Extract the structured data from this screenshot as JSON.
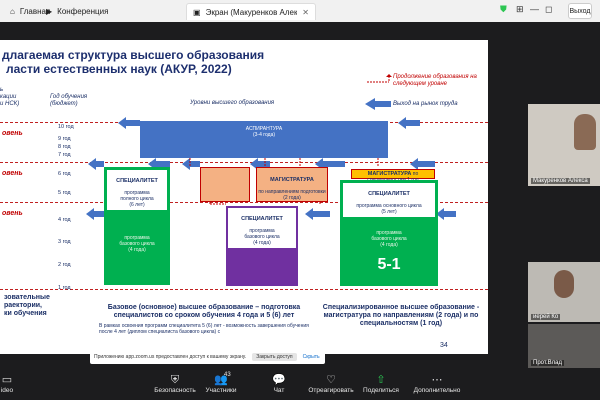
{
  "window": {
    "tabs": [
      {
        "label": "Главная"
      },
      {
        "label": "Конференция"
      },
      {
        "label": "Экран (Макуренков Александр"
      }
    ],
    "exit_label": "Выход"
  },
  "slide": {
    "title_line1": "длагаемая структура высшего образования",
    "title_line2": "ласти естественных наук (АКУР, 2022)",
    "legend": {
      "continue": "Продолжение образования на следующем уровне",
      "exit": "Выход на рынок труда"
    },
    "headers": {
      "left": "ь\nкации\nи НСК)",
      "years": "Год обучения\n(бюджет)",
      "levels": "Уровни высшего образования"
    },
    "years": [
      "10 год",
      "9 год",
      "8 год",
      "7 год",
      "6 год",
      "5 год",
      "4 год",
      "3 год",
      "2 год",
      "1 год"
    ],
    "level_labels": [
      "овень",
      "овень",
      "овень"
    ],
    "boxes": {
      "aspirantura": {
        "title": "АСПИРАНТУРА",
        "sub": "(3-4 года)"
      },
      "spec_full": {
        "title": "СПЕЦИАЛИТЕТ",
        "sub": "программа\nполного цикла\n(6 лет)"
      },
      "spec_full_low": {
        "sub": "программа\nбазового цикла\n(4 года)"
      },
      "mag_mid": {
        "title": "МАГИСТРАТУРА",
        "sub": "по направлениям подготовки\n(2 года)"
      },
      "mag_right_head": {
        "title": "МАГИСТРАТУРА",
        "sub": "по специальностям 1 год"
      },
      "spec_base": {
        "title": "СПЕЦИАЛИТЕТ",
        "sub": "программа\nбазового цикла\n(4 года)"
      },
      "spec_right": {
        "title": "СПЕЦИАЛИТЕТ",
        "sub": "программа основного цикла\n(5 лет)"
      },
      "spec_right_low": {
        "sub": "программа\nбазового цикла\n(4 года)"
      },
      "big_label": "5-1"
    },
    "bottom_left": "зовательные\nраектории,\nки обучения",
    "bottom_mid": "Базовое (основное) высшее образование – подготовка специалистов со сроком обучения 4 года и  5 (6) лет",
    "bottom_note": "В рамках освоения программ специалитета 5 (6) лет - возможность завершения обучения  после 4 лет (диплом специалиста базового цикла) с",
    "bottom_right": "Специализированное высшее образование - магистратура  по направлениям (2 года) и по специальностям (1 год)",
    "page": "34"
  },
  "notification": {
    "text": "Приложению app.zoom.us предоставлен доступ к вашему экрану.",
    "stop": "Закрыть доступ",
    "hide": "Скрыть"
  },
  "participants_side": [
    {
      "name": "Макуренков Алекса"
    },
    {
      "name": "иерей Ко"
    },
    {
      "name": "Прот.Влад"
    }
  ],
  "toolbar": {
    "items": [
      {
        "label": "ideo",
        "icon": "▭"
      },
      {
        "label": "Безопасность",
        "icon": "⛨"
      },
      {
        "label": "Участники",
        "icon": "👥",
        "badge": "43"
      },
      {
        "label": "Чат",
        "icon": "💬"
      },
      {
        "label": "Отреагировать",
        "icon": "♡"
      },
      {
        "label": "Поделиться",
        "icon": "⇧"
      },
      {
        "label": "Дополнительно",
        "icon": "⋯"
      }
    ]
  },
  "colors": {
    "blue": "#4472c4",
    "green": "#00b050",
    "purple": "#7030a0",
    "salmon": "#f4b183",
    "yellow": "#ffc000",
    "red": "#c00000"
  }
}
